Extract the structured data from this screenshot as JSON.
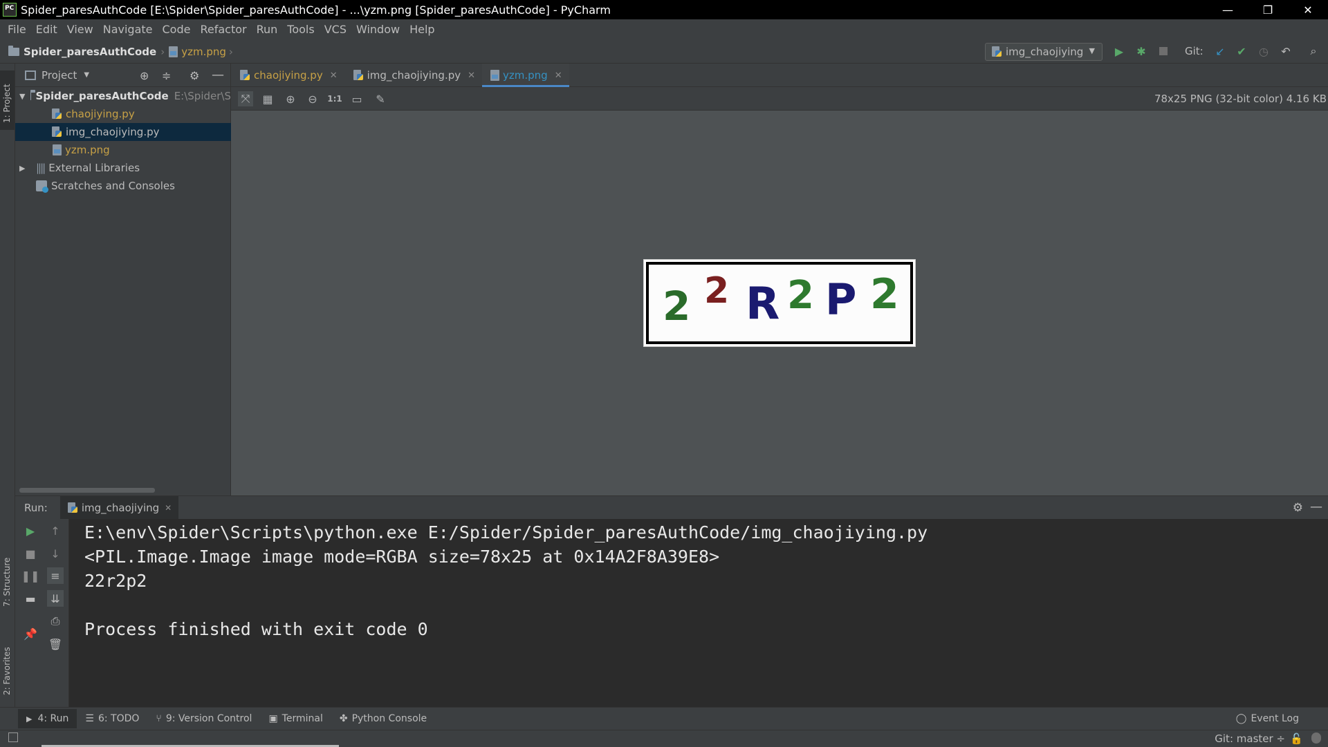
{
  "window": {
    "title": "Spider_paresAuthCode [E:\\Spider\\Spider_paresAuthCode] - ...\\yzm.png [Spider_paresAuthCode] - PyCharm",
    "controls": [
      "—",
      "❐",
      "✕"
    ]
  },
  "menu": [
    "File",
    "Edit",
    "View",
    "Navigate",
    "Code",
    "Refactor",
    "Run",
    "Tools",
    "VCS",
    "Window",
    "Help"
  ],
  "breadcrumb": {
    "project": "Spider_paresAuthCode",
    "file": "yzm.png"
  },
  "toolbar": {
    "run_config": "img_chaojiying",
    "git_label": "Git:"
  },
  "left_stripe": {
    "project_tab": "1: Project",
    "structure_tab": "7: Structure",
    "favorites_tab": "2: Favorites"
  },
  "project_panel": {
    "title": "Project",
    "tree": [
      {
        "label": "Spider_paresAuthCode",
        "path": "E:\\Spider\\S"
      },
      {
        "label": "chaojiying.py"
      },
      {
        "label": "img_chaojiying.py"
      },
      {
        "label": "yzm.png"
      },
      {
        "label": "External Libraries"
      },
      {
        "label": "Scratches and Consoles"
      }
    ]
  },
  "editor_tabs": [
    {
      "label": "chaojiying.py"
    },
    {
      "label": "img_chaojiying.py"
    },
    {
      "label": "yzm.png"
    }
  ],
  "image_viewer": {
    "info": "78x25 PNG (32-bit color) 4.16 KB",
    "actual_size": "1:1",
    "captcha_chars": [
      "2",
      "2",
      "R",
      "2",
      "P",
      "2"
    ],
    "colors": {
      "dark_green": "#2a6b2a",
      "maroon": "#7a2020",
      "navy": "#1a1a70",
      "green": "#2e7a2e"
    }
  },
  "run_panel": {
    "label": "Run:",
    "tab": "img_chaojiying",
    "console": [
      "E:\\env\\Spider\\Scripts\\python.exe E:/Spider/Spider_paresAuthCode/img_chaojiying.py",
      "<PIL.Image.Image image mode=RGBA size=78x25 at 0x14A2F8A39E8>",
      "22r2p2",
      "",
      "Process finished with exit code 0"
    ]
  },
  "bottom_tools": [
    "4: Run",
    "6: TODO",
    "9: Version Control",
    "Terminal",
    "Python Console"
  ],
  "event_log": "Event Log",
  "status": {
    "git": "Git: master ÷"
  },
  "colors": {
    "accent": "#4a88c7",
    "run_green": "#59a869",
    "bg": "#3c3f41",
    "console_bg": "#2b2b2b"
  }
}
